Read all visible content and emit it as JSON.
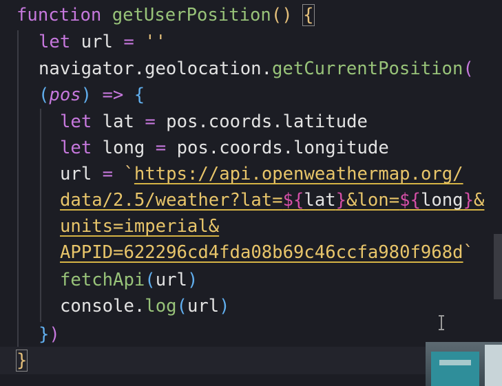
{
  "code": {
    "l1": {
      "kw": "function",
      "name": "getUserPosition",
      "parens": "()",
      "brace": "{"
    },
    "l2": {
      "kw": "let",
      "name": "url",
      "eq": "=",
      "str": "''"
    },
    "l3": {
      "obj": "navigator.geolocation.",
      "method": "getCurrentPosition",
      "paren": "("
    },
    "l4": {
      "open": "(",
      "param": "pos",
      "close": ")",
      "arrow": "=>",
      "brace": "{"
    },
    "l5": {
      "kw": "let",
      "name": "lat",
      "eq": "=",
      "value": "pos.coords.latitude"
    },
    "l6": {
      "kw": "let",
      "name": "long",
      "eq": "=",
      "value": "pos.coords.longitude"
    },
    "l7": {
      "name": "url",
      "eq": "=",
      "tick": "`",
      "url": "https://api.openweathermap.org/"
    },
    "l8": {
      "path": "data/2.5/weather?lat=",
      "d1": "${",
      "v1": "lat",
      "c1": "}",
      "mid": "&lon=",
      "d2": "${",
      "v2": "long",
      "c2": "}",
      "end": "&"
    },
    "l9": {
      "text": "units=imperial&"
    },
    "l10": {
      "text": "APPID=622296cd4fda08b69c46ccfa980f968d",
      "tick": "`"
    },
    "l11": {
      "fn": "fetchApi",
      "open": "(",
      "arg": "url",
      "close": ")"
    },
    "l12": {
      "obj": "console.",
      "fn": "log",
      "open": "(",
      "arg": "url",
      "close": ")"
    },
    "l13": {
      "brace": "}",
      "paren": ")"
    },
    "l14": {
      "brace": "}"
    }
  },
  "colors": {
    "background": "#1c1d24",
    "keyword": "#c678dd",
    "function": "#98c379",
    "string": "#e5c07b",
    "text": "#e3e3e3"
  }
}
